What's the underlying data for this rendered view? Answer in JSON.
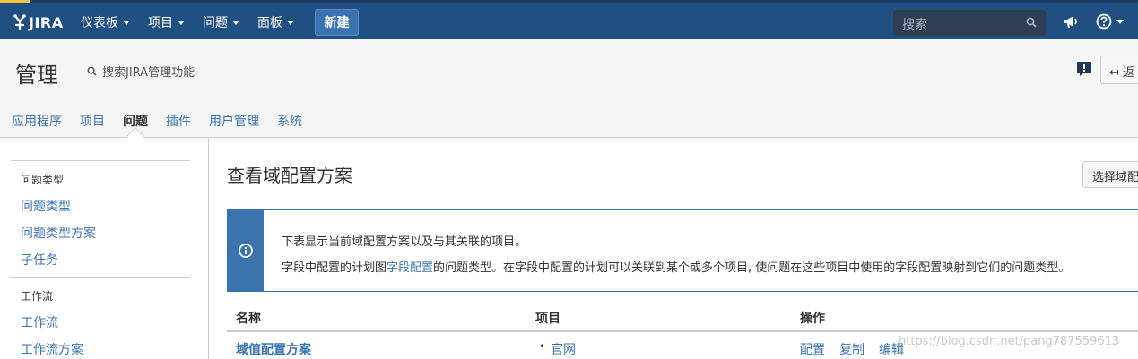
{
  "topnav": {
    "logo": "JIRA",
    "items": [
      {
        "label": "仪表板"
      },
      {
        "label": "项目"
      },
      {
        "label": "问题"
      },
      {
        "label": "面板"
      }
    ],
    "create_label": "新建",
    "search_placeholder": "搜索",
    "icons": [
      "megaphone-icon",
      "help-icon"
    ]
  },
  "admin": {
    "title": "管理",
    "search_label": "搜索JIRA管理功能",
    "back_label": "返"
  },
  "tabs": [
    {
      "label": "应用程序"
    },
    {
      "label": "项目"
    },
    {
      "label": "问题",
      "active": true
    },
    {
      "label": "插件"
    },
    {
      "label": "用户管理"
    },
    {
      "label": "系统"
    }
  ],
  "sidebar": {
    "sections": [
      {
        "heading": "问题类型",
        "links": [
          "问题类型",
          "问题类型方案",
          "子任务"
        ]
      },
      {
        "heading": "工作流",
        "links": [
          "工作流",
          "工作流方案"
        ]
      }
    ]
  },
  "main": {
    "title": "查看域配置方案",
    "choose_button": "选择域配",
    "info": {
      "line1": "下表显示当前域配置方案以及与其关联的项目。",
      "line2_pre": "字段中配置的计划图",
      "line2_link": "字段配置",
      "line2_post": "的问题类型。在字段中配置的计划可以关联到某个或多个项目, 使问题在这些项目中使用的字段配置映射到它们的问题类型。"
    },
    "table": {
      "headers": [
        "名称",
        "项目",
        "操作"
      ],
      "rows": [
        {
          "name": "域值配置方案",
          "project": "官网",
          "actions": [
            "配置",
            "复制",
            "编辑"
          ]
        }
      ]
    }
  },
  "watermark": "https://blog.csdn.net/pang787559613",
  "colors": {
    "topbar": "#205081",
    "link": "#3b73af",
    "create_button": "#3b73af",
    "search_bg": "#2e3d54"
  }
}
